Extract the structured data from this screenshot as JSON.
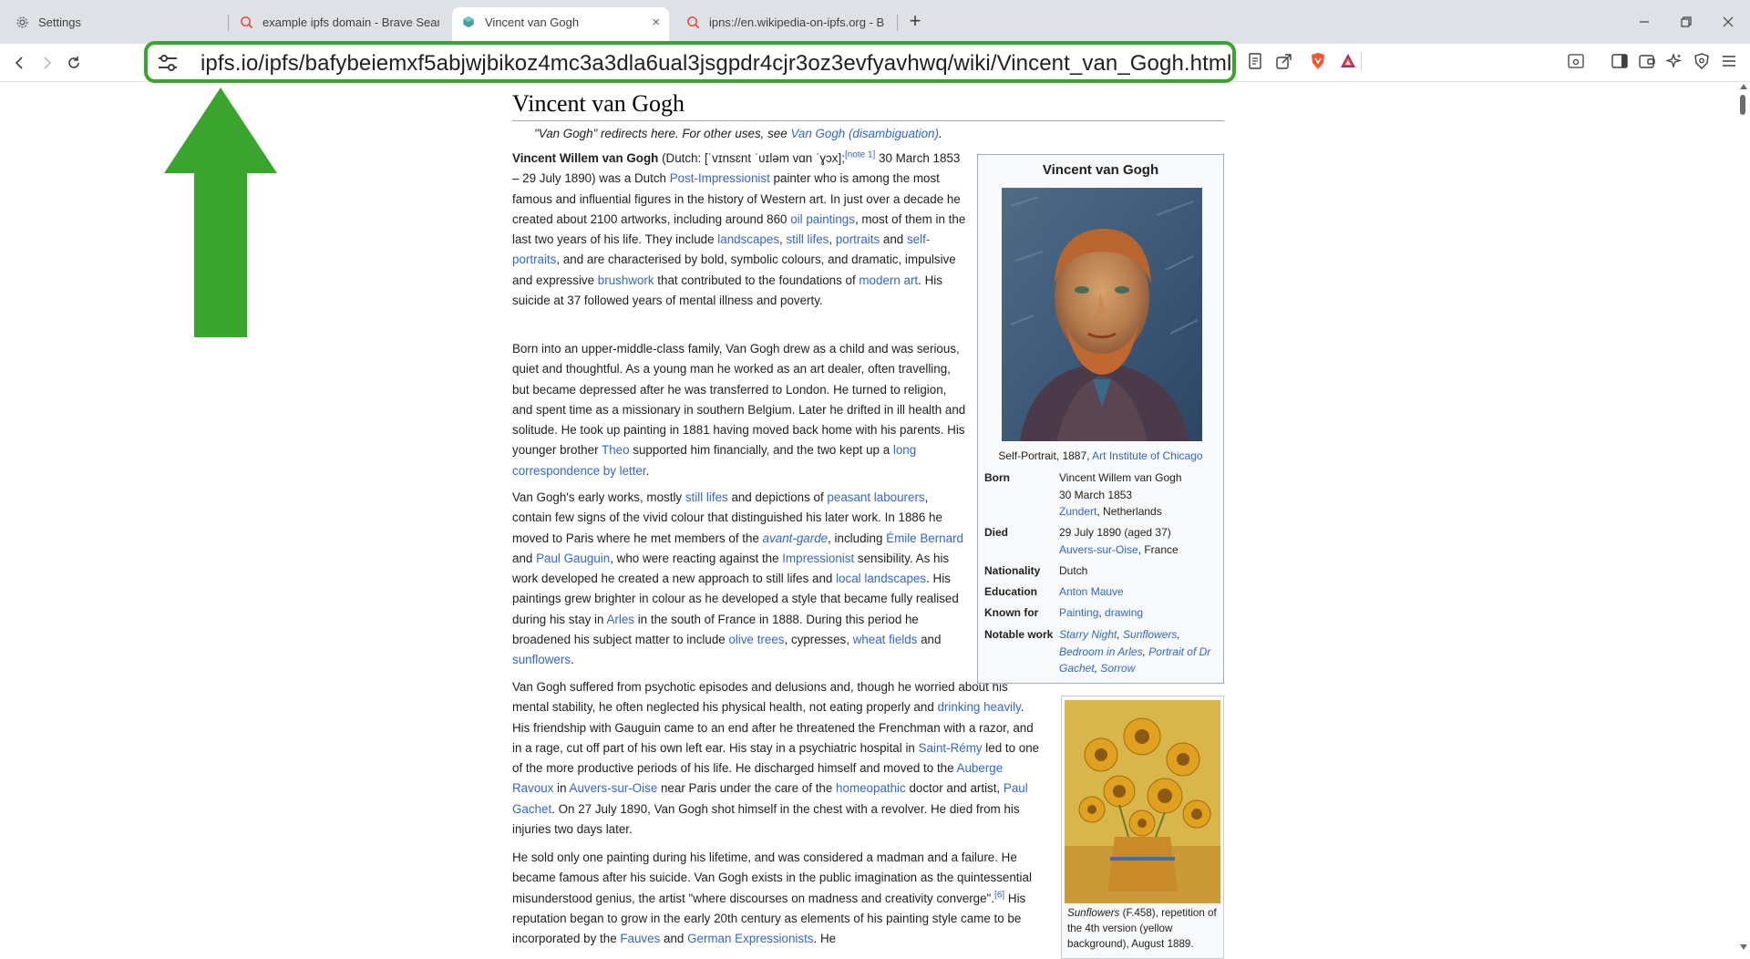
{
  "browser": {
    "tabs": [
      {
        "label": "Settings",
        "icon": "gear-icon",
        "active": false
      },
      {
        "label": "example ipfs domain - Brave Search",
        "icon": "brave-search-icon",
        "active": false
      },
      {
        "label": "Vincent van Gogh",
        "icon": "ipfs-cube-icon",
        "active": true
      },
      {
        "label": "ipns://en.wikipedia-on-ipfs.org - Brave",
        "icon": "brave-search-icon",
        "active": false
      }
    ],
    "new_tab_symbol": "+",
    "close_symbol": "×",
    "url": "ipfs.io/ipfs/bafybeiemxf5abjwjbikoz4mc3a3dla6ual3jsgpdr4cjr3oz3evfyavhwq/wiki/Vincent_van_Gogh.html",
    "address_highlight_color": "#3aa52c",
    "arrow_color": "#3aa52c"
  },
  "article": {
    "title": "Vincent van Gogh",
    "hatnote_prefix": "\"Van Gogh\" redirects here. For other uses, see ",
    "hatnote_link": "Van Gogh (disambiguation)",
    "hatnote_suffix": ".",
    "p1": {
      "bold_name": "Vincent Willem van Gogh",
      "t1": " (Dutch: [ˈvɪnsɛnt ˈʋɪləm vɑn ˈɣɔx];",
      "note": "[note 1]",
      "t2": " 30 March 1853 – 29 July 1890) was a Dutch ",
      "l_postimp": "Post-Impressionist",
      "t3": " painter who is among the most famous and influential figures in the history of Western art. In just over a decade he created about 2100 artworks, including around 860 ",
      "l_oil": "oil paintings",
      "t4": ", most of them in the last two years of his life. They include ",
      "l_landscapes": "landscapes",
      "t5": ", ",
      "l_stilllifes": "still lifes",
      "t6": ", ",
      "l_portraits": "portraits",
      "t7": " and ",
      "l_selfportraits": "self-portraits",
      "t8": ", and are characterised by bold, symbolic colours, and dramatic, impulsive and expressive ",
      "l_brushwork": "brushwork",
      "t9": " that contributed to the foundations of ",
      "l_modernart": "modern art",
      "t10": ". His suicide at 37 followed years of mental illness and poverty."
    },
    "p2": {
      "t1": "Born into an upper-middle-class family, Van Gogh drew as a child and was serious, quiet and thoughtful. As a young man he worked as an art dealer, often travelling, but became depressed after he was transferred to London. He turned to religion, and spent time as a missionary in southern Belgium. Later he drifted in ill health and solitude. He took up painting in 1881 having moved back home with his parents. His younger brother ",
      "l_theo": "Theo",
      "t2": " supported him financially, and the two kept up a ",
      "l_corr": "long correspondence by letter",
      "t3": "."
    },
    "p3": {
      "t1": "Van Gogh's early works, mostly ",
      "l_stilllifes": "still lifes",
      "t2": " and depictions of ",
      "l_peasant": "peasant labourers",
      "t3": ", contain few signs of the vivid colour that distinguished his later work. In 1886 he moved to Paris where he met members of the ",
      "l_avantgarde": "avant-garde",
      "t4": ", including ",
      "l_bernard": "Émile Bernard",
      "t5": " and ",
      "l_gauguin": "Paul Gauguin",
      "t6": ", who were reacting against the ",
      "l_impressionist": "Impressionist",
      "t7": " sensibility. As his work developed he created a new approach to still lifes and ",
      "l_local": "local landscapes",
      "t8": ". His paintings grew brighter in colour as he developed a style that became fully realised during his stay in ",
      "l_arles": "Arles",
      "t9": " in the south of France in 1888. During this period he broadened his subject matter to include ",
      "l_olive": "olive trees",
      "t10": ", cypresses, ",
      "l_wheat": "wheat fields",
      "t11": " and ",
      "l_sunflowers": "sunflowers",
      "t12": "."
    },
    "p4": {
      "t1": "Van Gogh suffered from psychotic episodes and delusions and, though he worried about his mental stability, he often neglected his physical health, not eating properly and ",
      "l_drinking": "drinking heavily",
      "t2": ". His friendship with Gauguin came to an end after he threatened the Frenchman with a razor, and in a rage, cut off part of his own left ear. His stay in a psychiatric hospital in ",
      "l_saintremy": "Saint-Rémy",
      "t3": " led to one of the more productive periods of his life. He discharged himself and moved to the ",
      "l_auberge": "Auberge Ravoux",
      "t4": " in ",
      "l_auvers": "Auvers-sur-Oise",
      "t5": " near Paris under the care of the ",
      "l_homeopathic": "homeopathic",
      "t6": " doctor and artist, ",
      "l_gachet": "Paul Gachet",
      "t7": ". On 27 July 1890, Van Gogh shot himself in the chest with a revolver. He died from his injuries two days later."
    },
    "p5": {
      "t1": "He sold only one painting during his lifetime, and was considered a madman and a failure. He became famous after his suicide. Van Gogh exists in the public imagination as the quintessential misunderstood genius, the artist \"where discourses on madness and creativity converge\".",
      "ref": "[6]",
      "t2": " His reputation began to grow in the early 20th century as elements of his painting style came to be incorporated by the ",
      "l_fauves": "Fauves",
      "t3": " and ",
      "l_german": "German Expressionists",
      "t4": ". He"
    }
  },
  "infobox": {
    "title": "Vincent van Gogh",
    "caption_text": "Self-Portrait, 1887, ",
    "caption_link": "Art Institute of Chicago",
    "born_label": "Born",
    "born_name": "Vincent Willem van Gogh",
    "born_date": "30 March 1853",
    "born_place_link": "Zundert",
    "born_place_rest": ", Netherlands",
    "died_label": "Died",
    "died_date": "29 July 1890 (aged 37)",
    "died_place_link": "Auvers-sur-Oise",
    "died_place_rest": ", France",
    "nationality_label": "Nationality",
    "nationality": "Dutch",
    "education_label": "Education",
    "education": "Anton Mauve",
    "knownfor_label": "Known for",
    "knownfor_1": "Painting",
    "knownfor_sep": ", ",
    "knownfor_2": "drawing",
    "notable_label": "Notable work",
    "notable_1": "Starry Night",
    "notable_2": "Sunflowers",
    "notable_3": "Bedroom in Arles",
    "notable_4": "Portrait of Dr Gachet",
    "notable_5": "Sorrow",
    "comma": ", "
  },
  "thumb": {
    "caption_italic": "Sunflowers",
    "caption_rest": " (F.458), repetition of the 4th version (yellow background), August 1889."
  }
}
